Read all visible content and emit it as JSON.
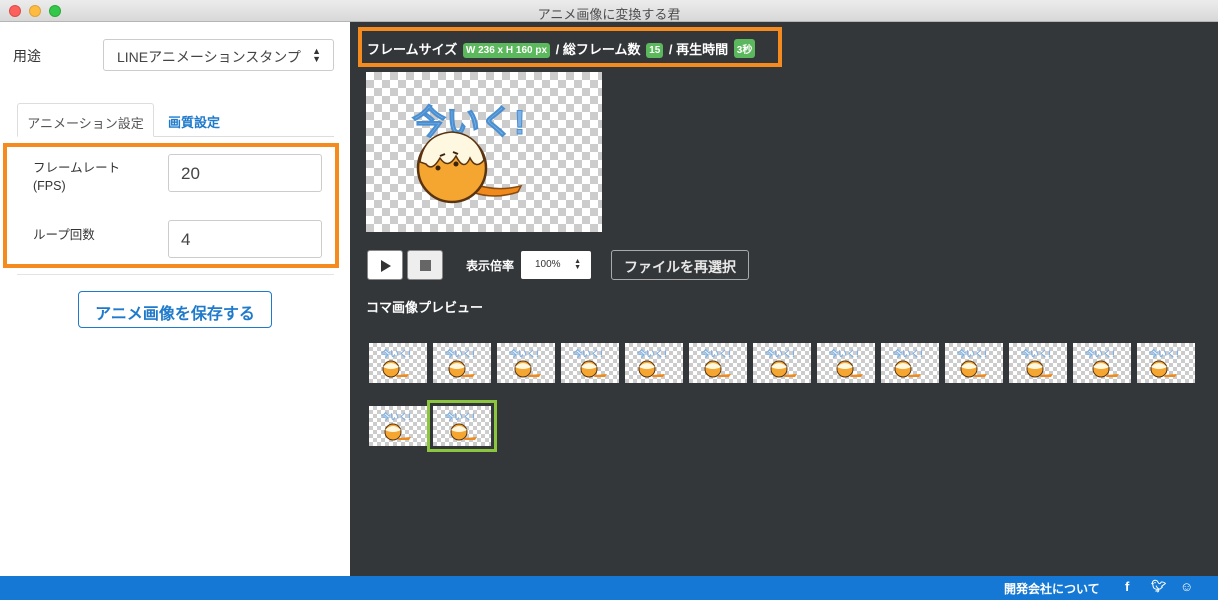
{
  "window": {
    "title": "アニメ画像に変換する君"
  },
  "usage": {
    "label": "用途",
    "value": "LINEアニメーションスタンプ"
  },
  "tabs": [
    {
      "label": "アニメーション設定",
      "active": true
    },
    {
      "label": "画質設定",
      "active": false
    }
  ],
  "animation_settings": {
    "frame_rate_label": "フレームレート\n(FPS)",
    "frame_rate_value": "20",
    "loop_label": "ループ回数",
    "loop_value": "4"
  },
  "save_button": "アニメ画像を保存する",
  "info": {
    "frame_size_label": "フレームサイズ",
    "frame_size_badge": "W 236 x H 160 px",
    "sep1": "/",
    "total_frames_label": "総フレーム数",
    "total_frames_badge": "15",
    "sep2": "/",
    "duration_label": "再生時間",
    "duration_badge": "3秒"
  },
  "preview": {
    "image_text": "今いく!"
  },
  "controls": {
    "zoom_label": "表示倍率",
    "zoom_value": "100%",
    "reselect_button": "ファイルを再選択"
  },
  "frames_label": "コマ画像プレビュー",
  "frames": {
    "count": 15,
    "selected_index": 14,
    "thumb_text": "今いく!"
  },
  "footer": {
    "about_link": "開発会社について",
    "icons": [
      "facebook-icon",
      "twitter-icon",
      "smiley-icon"
    ]
  },
  "colors": {
    "highlight": "#f58a1f",
    "accent": "#1f7acb",
    "badge": "#5cb85c",
    "selected_frame": "#8cc63f",
    "status_bar": "#1478d4",
    "dark_panel": "#34373a"
  }
}
